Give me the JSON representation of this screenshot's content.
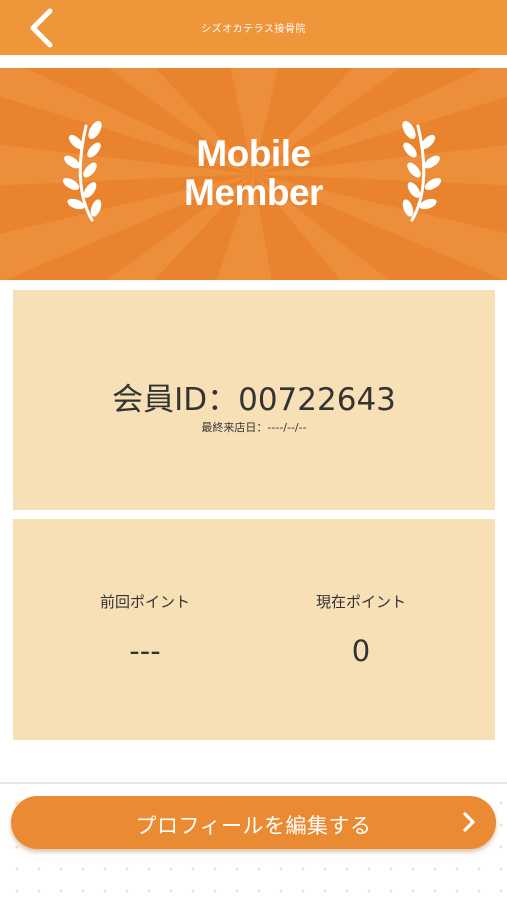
{
  "header": {
    "title": "シズオカテラス接骨院",
    "back_icon": "chevron-left-icon"
  },
  "banner": {
    "line1": "Mobile",
    "line2": "Member",
    "laurel_icon": "laurel-icon"
  },
  "member": {
    "id_text": "会員ID：00722643",
    "last_visit": "最終来店日：----/--/--"
  },
  "points": {
    "previous_label": "前回ポイント",
    "previous_value": "---",
    "current_label": "現在ポイント",
    "current_value": "0"
  },
  "actions": {
    "edit_profile_label": "プロフィールを編集する",
    "edit_chevron_icon": "chevron-right-icon"
  },
  "colors": {
    "header": "#f0963a",
    "banner": "#e9832e",
    "card": "#f8e0b6",
    "button": "#ea8a32"
  }
}
